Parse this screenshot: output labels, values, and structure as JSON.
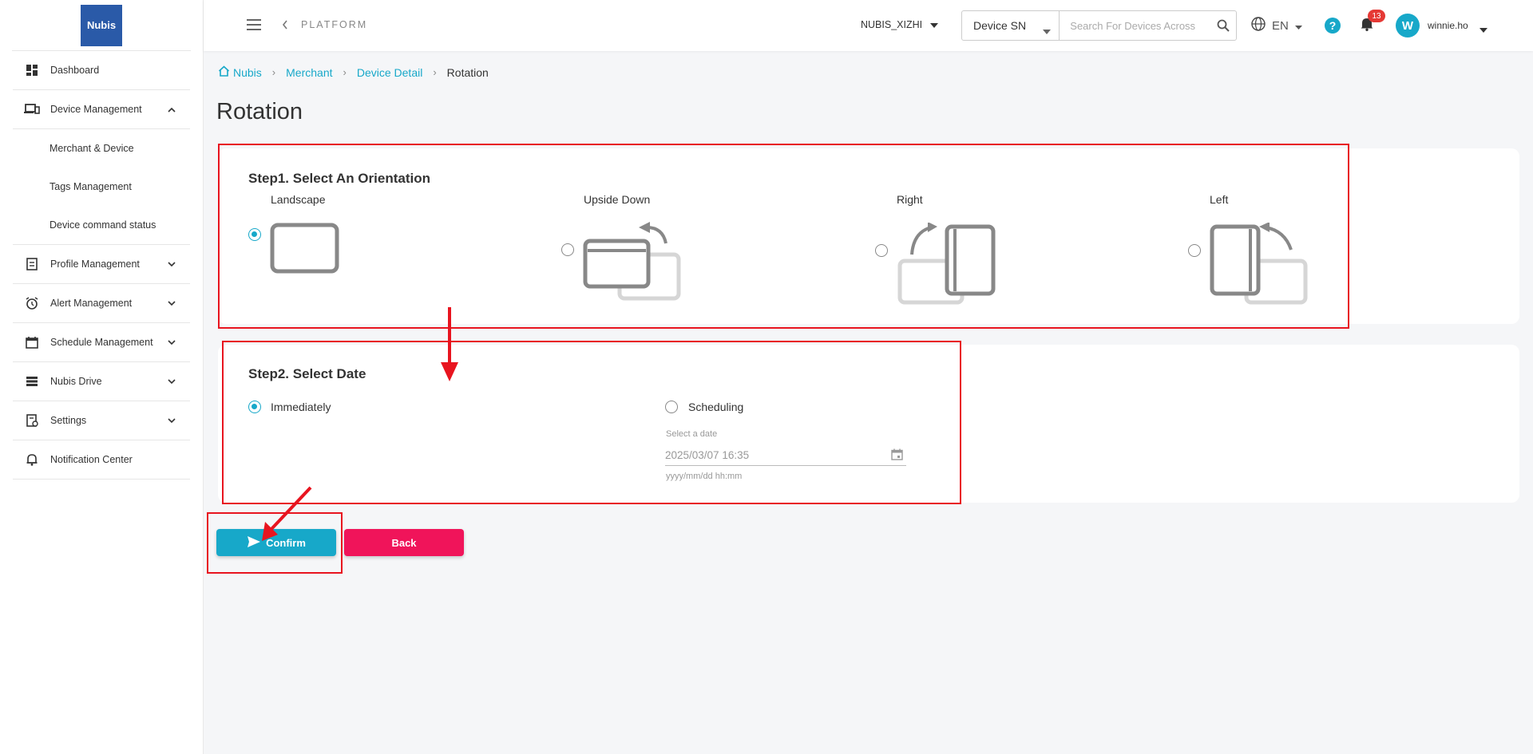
{
  "logo": {
    "text": "Nubis"
  },
  "sidebar": {
    "items": [
      {
        "label": "Dashboard",
        "icon": "dashboard-icon"
      },
      {
        "label": "Device Management",
        "icon": "devices-icon",
        "expanded": true
      },
      {
        "label": "Profile Management",
        "icon": "profile-icon"
      },
      {
        "label": "Alert Management",
        "icon": "alarm-icon"
      },
      {
        "label": "Schedule Management",
        "icon": "calendar-icon"
      },
      {
        "label": "Nubis Drive",
        "icon": "storage-icon"
      },
      {
        "label": "Settings",
        "icon": "settings-icon"
      },
      {
        "label": "Notification Center",
        "icon": "bell-icon"
      }
    ],
    "device_sub": [
      "Merchant & Device",
      "Tags Management",
      "Device command status"
    ]
  },
  "header": {
    "platform": "PLATFORM",
    "merchant": "NUBIS_XIZHI",
    "search_type": "Device SN",
    "search_placeholder": "Search For Devices Across",
    "lang": "EN",
    "notif_count": "13",
    "avatar_initial": "W",
    "username": "winnie.ho"
  },
  "breadcrumb": {
    "home": "Nubis",
    "merchant": "Merchant",
    "detail": "Device Detail",
    "current": "Rotation"
  },
  "page_title": "Rotation",
  "step1": {
    "title": "Step1. Select An Orientation",
    "options": [
      "Landscape",
      "Upside Down",
      "Right",
      "Left"
    ],
    "selected": "Landscape"
  },
  "step2": {
    "title": "Step2. Select Date",
    "immediately": "Immediately",
    "scheduling": "Scheduling",
    "selected": "Immediately",
    "date_label": "Select a date",
    "date_value": "2025/03/07 16:35",
    "date_hint": "yyyy/mm/dd hh:mm"
  },
  "buttons": {
    "confirm": "Confirm",
    "back": "Back"
  },
  "colors": {
    "accent": "#17a8c9",
    "danger": "#f0145a",
    "annotation": "#e8141f",
    "logo": "#2a5aa8"
  }
}
